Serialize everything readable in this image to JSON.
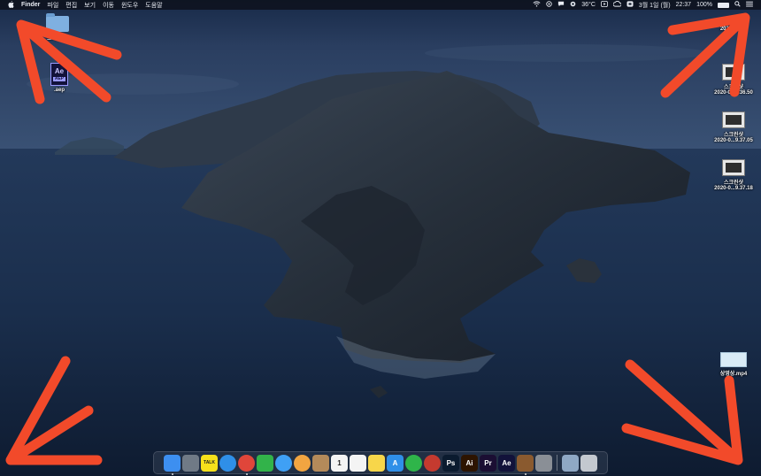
{
  "menubar": {
    "apple_icon": "apple-icon",
    "app_name": "Finder",
    "menus": [
      "파일",
      "편집",
      "보기",
      "이동",
      "윈도우",
      "도움말"
    ],
    "status": {
      "temperature": "36°C",
      "date": "3월 1일 (월)",
      "time": "22:37",
      "battery": "100%",
      "battery_level": 1.0
    }
  },
  "desktop_icons": {
    "left": [
      {
        "label": "프리 작업",
        "kind": "folder"
      },
      {
        "label": ".aep",
        "kind": "ae-project",
        "badge": "Ae",
        "sub": "AEP"
      }
    ],
    "right": [
      {
        "label": "2020-0...43",
        "kind": "screenshot"
      },
      {
        "label": "스크린샷\n2020-0...9.36.50",
        "kind": "screenshot"
      },
      {
        "label": "스크린샷\n2020-0...9.37.05",
        "kind": "screenshot"
      },
      {
        "label": "스크린샷\n2020-0...9.37.18",
        "kind": "screenshot"
      },
      {
        "label": "상영상.mp4",
        "kind": "video"
      }
    ]
  },
  "dock": {
    "apps": [
      {
        "name": "finder-icon",
        "text": "",
        "color": "#3d8ff0"
      },
      {
        "name": "launchpad-icon",
        "text": "",
        "color": "#707a86"
      },
      {
        "name": "kakaotalk-icon",
        "text": "TALK",
        "color": "#f7e11b"
      },
      {
        "name": "safari-icon",
        "text": "",
        "color": "#2f8fe8"
      },
      {
        "name": "chrome-icon",
        "text": "",
        "color": "#e0463a"
      },
      {
        "name": "facetime-icon",
        "text": "",
        "color": "#32b34a"
      },
      {
        "name": "messages-icon",
        "text": "",
        "color": "#3fa0f5"
      },
      {
        "name": "photos-icon",
        "text": "",
        "color": "#f2a541"
      },
      {
        "name": "contacts-icon",
        "text": "",
        "color": "#b48a5a"
      },
      {
        "name": "calendar-icon",
        "text": "1",
        "color": "#f4f4f4"
      },
      {
        "name": "reminders-icon",
        "text": "",
        "color": "#f4f4f4"
      },
      {
        "name": "notes-icon",
        "text": "",
        "color": "#f7d64a"
      },
      {
        "name": "appstore-icon",
        "text": "A",
        "color": "#2f8fe8"
      },
      {
        "name": "tethering-icon",
        "text": "",
        "color": "#2fb54a"
      },
      {
        "name": "screenrecorder-icon",
        "text": "",
        "color": "#c53a2f"
      },
      {
        "name": "photoshop-icon",
        "text": "Ps",
        "color": "#0b1b2f"
      },
      {
        "name": "illustrator-icon",
        "text": "Ai",
        "color": "#2d1400"
      },
      {
        "name": "premiere-icon",
        "text": "Pr",
        "color": "#1b0e33"
      },
      {
        "name": "aftereffects-icon",
        "text": "Ae",
        "color": "#12123a"
      },
      {
        "name": "character-app-icon",
        "text": "",
        "color": "#8a5a2f"
      },
      {
        "name": "system-preferences-icon",
        "text": "",
        "color": "#8a8f96"
      }
    ],
    "right": [
      {
        "name": "downloads-icon",
        "text": "",
        "color": "#8fa8c4"
      },
      {
        "name": "trash-icon",
        "text": "",
        "color": "#c3c8cf"
      }
    ]
  }
}
